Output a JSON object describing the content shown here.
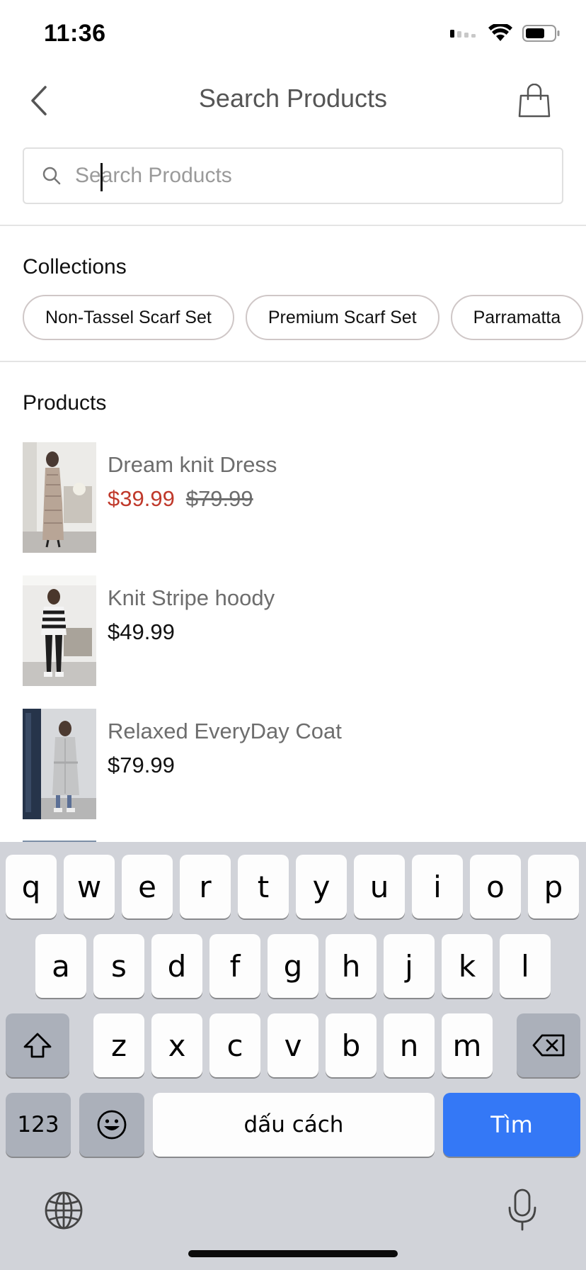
{
  "status_bar": {
    "time": "11:36"
  },
  "nav": {
    "title": "Search Products"
  },
  "search": {
    "placeholder": "Search Products",
    "value": ""
  },
  "collections": {
    "title": "Collections",
    "items": [
      "Non-Tassel Scarf Set",
      "Premium Scarf Set",
      "Parramatta"
    ]
  },
  "products": {
    "title": "Products",
    "items": [
      {
        "name": "Dream knit Dress",
        "sale_price": "$39.99",
        "original_price": "$79.99"
      },
      {
        "name": "Knit Stripe hoody",
        "price": "$49.99"
      },
      {
        "name": "Relaxed EveryDay Coat",
        "price": "$79.99"
      }
    ]
  },
  "keyboard": {
    "row1": [
      "q",
      "w",
      "e",
      "r",
      "t",
      "y",
      "u",
      "i",
      "o",
      "p"
    ],
    "row2": [
      "a",
      "s",
      "d",
      "f",
      "g",
      "h",
      "j",
      "k",
      "l"
    ],
    "row3": [
      "z",
      "x",
      "c",
      "v",
      "b",
      "n",
      "m"
    ],
    "numbers_label": "123",
    "space_label": "dấu cách",
    "return_label": "Tìm"
  },
  "colors": {
    "sale": "#c0392b",
    "accent": "#3478f6",
    "keyboard_bg": "#d1d3d9"
  }
}
